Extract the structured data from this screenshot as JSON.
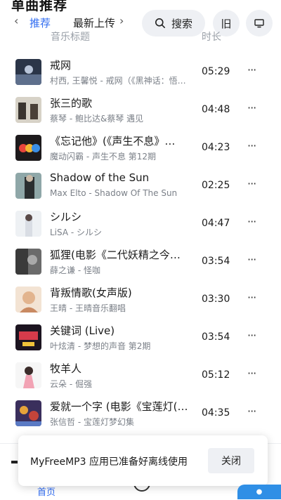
{
  "page": {
    "title": "单曲推荐"
  },
  "tabs": [
    {
      "label": "推荐",
      "active": true
    },
    {
      "label": "最新上传",
      "active": false
    }
  ],
  "search": {
    "label": "搜索"
  },
  "old_button": {
    "label": "旧"
  },
  "columns": {
    "title": "音乐标题",
    "duration": "时长"
  },
  "songs": [
    {
      "title": "戒网",
      "subtitle": "村西, 王馨悦 - 戒网（《黑神话：悟空》",
      "duration": "05:29"
    },
    {
      "title": "张三的歌",
      "subtitle": "蔡琴 - 鲍比达&蔡琴 遇见",
      "duration": "04:48"
    },
    {
      "title": "《忘记他》(《声生不息》…",
      "subtitle": "魔动闪霸 - 声生不息 第12期",
      "duration": "04:23"
    },
    {
      "title": "Shadow of the Sun",
      "subtitle": "Max Elto - Shadow Of The Sun",
      "duration": "02:25"
    },
    {
      "title": "シルシ",
      "subtitle": "LiSA - シルシ",
      "duration": "04:47"
    },
    {
      "title": "狐狸(电影《二代妖精之今生有幸》",
      "subtitle": "薛之谦 - 怪咖",
      "duration": "03:54"
    },
    {
      "title": "背叛情歌(女声版)",
      "subtitle": "王晴 - 王晴音乐翻唱",
      "duration": "03:30"
    },
    {
      "title": "关键词 (Live)",
      "subtitle": "叶炫清 - 梦想的声音 第2期",
      "duration": "03:54"
    },
    {
      "title": "牧羊人",
      "subtitle": "云朵 - 倔强",
      "duration": "05:12"
    },
    {
      "title": "爱就一个字 (电影《宝莲灯(…",
      "subtitle": "张信哲 - 宝莲灯梦幻集",
      "duration": "04:35"
    }
  ],
  "more_glyph": "···",
  "bottom_nav": {
    "home_label": "首页"
  },
  "toast": {
    "message": "MyFreeMP3 应用已准备好离线使用",
    "close_label": "关闭"
  },
  "colors": {
    "accent": "#2f6bf0",
    "pill_bg": "#eef0f4",
    "muted": "#7b8088"
  }
}
